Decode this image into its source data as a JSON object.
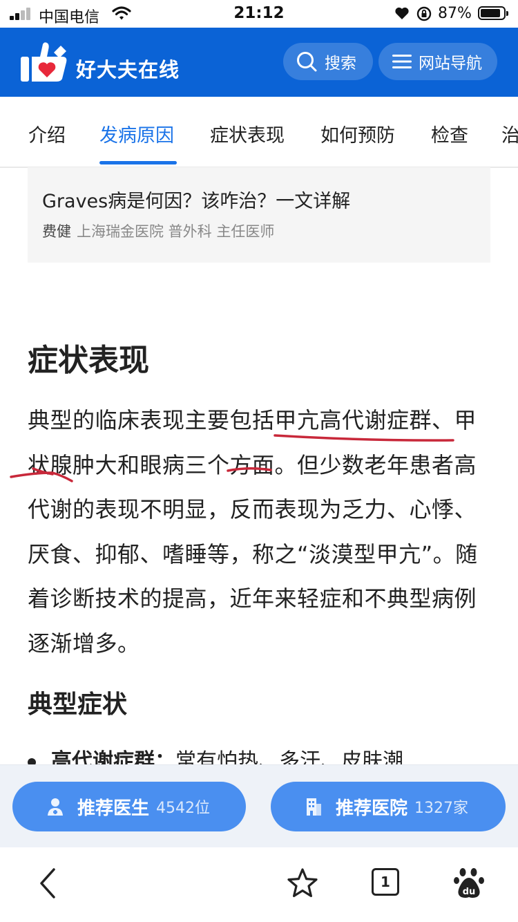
{
  "status_bar": {
    "carrier": "中国电信",
    "time": "21:12",
    "battery": "87%"
  },
  "header": {
    "brand": "好大夫在线",
    "search_label": "搜索",
    "nav_label": "网站导航"
  },
  "tabs": [
    {
      "label": "介绍",
      "active": false
    },
    {
      "label": "发病原因",
      "active": true
    },
    {
      "label": "症状表现",
      "active": false
    },
    {
      "label": "如何预防",
      "active": false
    },
    {
      "label": "检查",
      "active": false
    },
    {
      "label": "治",
      "active": false
    }
  ],
  "article_card": {
    "title": "Graves病是何因？该咋治？一文详解",
    "author": "费健",
    "hospital_info": "上海瑞金医院 普外科 主任医师"
  },
  "content": {
    "section_title": "症状表现",
    "paragraph": "典型的临床表现主要包括甲亢高代谢症群、甲状腺肿大和眼病三个方面。但少数老年患者高代谢的表现不明显，反而表现为乏力、心悸、厌食、抑郁、嗜睡等，称之“淡漠型甲亢”。随着诊断技术的提高，近年来轻症和不典型病例逐渐增多。",
    "sub_title": "典型症状",
    "bullet_term": "高代谢症群：",
    "bullet_text": "常有怕热、多汗、皮肤潮"
  },
  "recommend": {
    "doctor_label": "推荐医生",
    "doctor_count": "4542位",
    "hospital_label": "推荐医院",
    "hospital_count": "1327家"
  },
  "browser_bar": {
    "tab_count": "1"
  },
  "colors": {
    "header_blue": "#0b63d6",
    "accent_blue": "#1a73e8",
    "button_blue": "#4a8ff0",
    "annotation_red": "#c8283a"
  }
}
